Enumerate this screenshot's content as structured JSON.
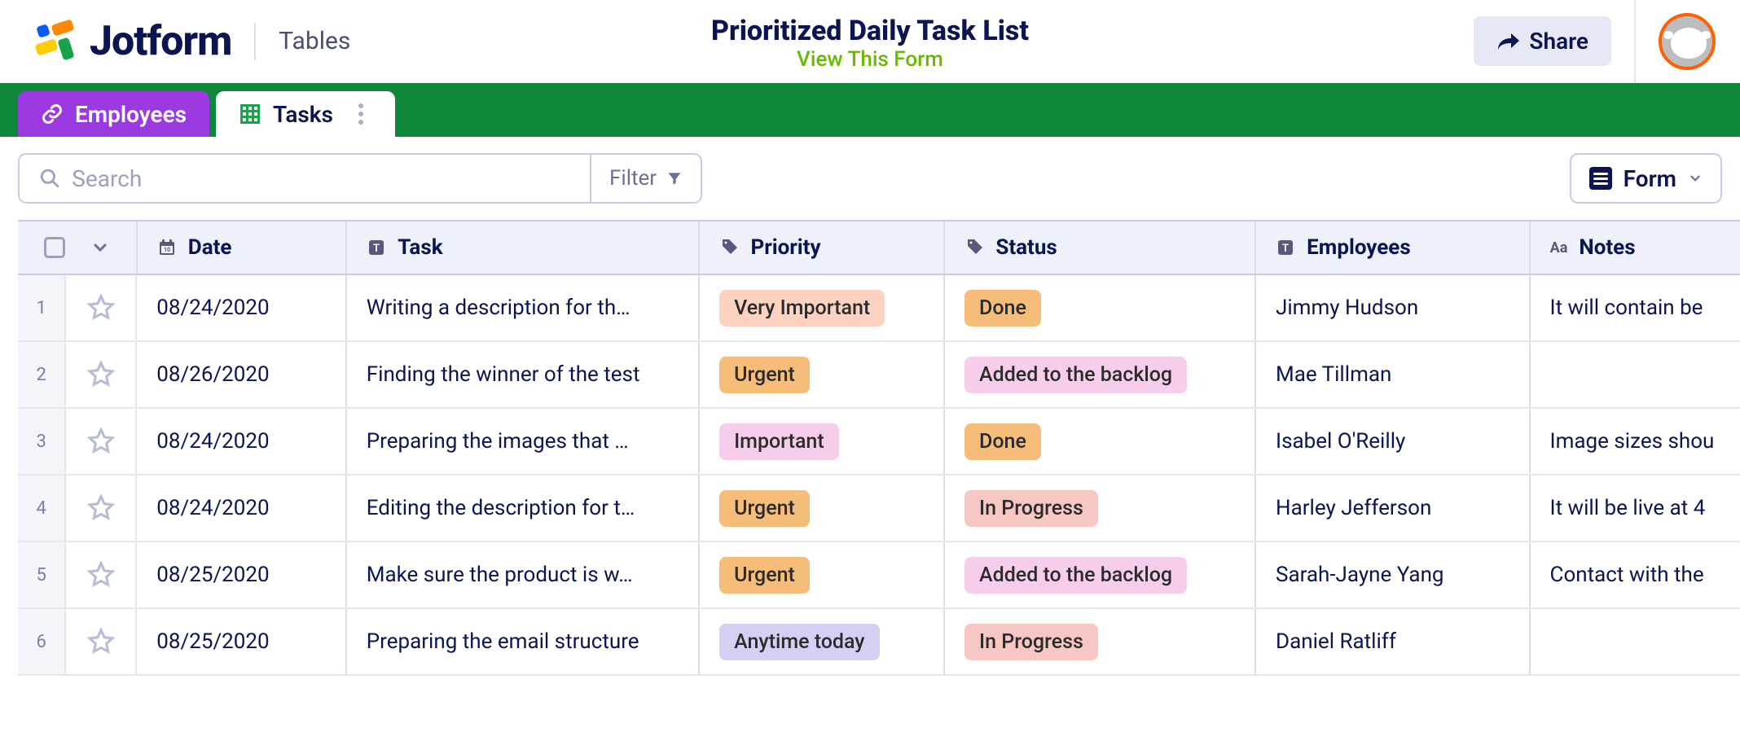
{
  "header": {
    "brand": "Jotform",
    "app": "Tables",
    "title": "Prioritized Daily Task List",
    "view_form": "View This Form",
    "share": "Share"
  },
  "tabs": {
    "employees": "Employees",
    "tasks": "Tasks"
  },
  "toolbar": {
    "search_placeholder": "Search",
    "filter": "Filter",
    "form_btn": "Form"
  },
  "columns": {
    "date": "Date",
    "task": "Task",
    "priority": "Priority",
    "status": "Status",
    "employees": "Employees",
    "notes": "Notes"
  },
  "priority_colors": {
    "Very Important": "t-peach",
    "Urgent": "t-orange",
    "Important": "t-pink",
    "Anytime today": "t-lav"
  },
  "status_colors": {
    "Done": "t-orange",
    "Added to the backlog": "t-pink",
    "In Progress": "t-salmon"
  },
  "rows": [
    {
      "n": "1",
      "date": "08/24/2020",
      "task": "Writing a description for th…",
      "priority": "Very Important",
      "status": "Done",
      "employee": "Jimmy Hudson",
      "notes": "It will contain be"
    },
    {
      "n": "2",
      "date": "08/26/2020",
      "task": "Finding the winner of the test",
      "priority": "Urgent",
      "status": "Added to the backlog",
      "employee": "Mae Tillman",
      "notes": ""
    },
    {
      "n": "3",
      "date": "08/24/2020",
      "task": "Preparing the images that …",
      "priority": "Important",
      "status": "Done",
      "employee": "Isabel O'Reilly",
      "notes": "Image sizes shou"
    },
    {
      "n": "4",
      "date": "08/24/2020",
      "task": "Editing the description for t…",
      "priority": "Urgent",
      "status": "In Progress",
      "employee": "Harley Jefferson",
      "notes": "It will be live at 4"
    },
    {
      "n": "5",
      "date": "08/25/2020",
      "task": "Make sure the product is w…",
      "priority": "Urgent",
      "status": "Added to the backlog",
      "employee": "Sarah-Jayne Yang",
      "notes": "Contact with the"
    },
    {
      "n": "6",
      "date": "08/25/2020",
      "task": "Preparing the email structure",
      "priority": "Anytime today",
      "status": "In Progress",
      "employee": "Daniel Ratliff",
      "notes": ""
    }
  ]
}
